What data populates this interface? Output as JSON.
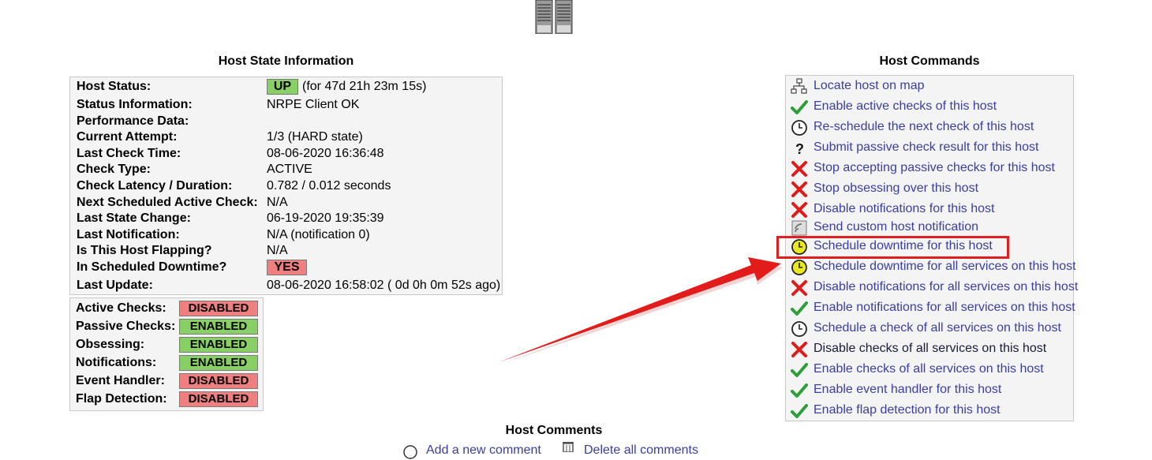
{
  "host_state": {
    "title": "Host State Information",
    "rows": [
      {
        "label": "Host Status:",
        "badge": "UP",
        "value": "(for 47d 21h 23m 15s)"
      },
      {
        "label": "Status Information:",
        "value": "NRPE Client OK"
      },
      {
        "label": "Performance Data:",
        "value": ""
      },
      {
        "label": "Current Attempt:",
        "value": "1/3  (HARD state)"
      },
      {
        "label": "Last Check Time:",
        "value": "08-06-2020 16:36:48"
      },
      {
        "label": "Check Type:",
        "value": "ACTIVE"
      },
      {
        "label": "Check Latency / Duration:",
        "value": "0.782 / 0.012 seconds"
      },
      {
        "label": "Next Scheduled Active Check:",
        "value": "N/A"
      },
      {
        "label": "Last State Change:",
        "value": "06-19-2020 19:35:39"
      },
      {
        "label": "Last Notification:",
        "value": "N/A (notification 0)"
      },
      {
        "label": "Is This Host Flapping?",
        "value": "N/A"
      },
      {
        "label": "In Scheduled Downtime?",
        "badge": "YES",
        "value": ""
      },
      {
        "label": "Last Update:",
        "value": "08-06-2020 16:58:02  ( 0d 0h 0m 52s ago)"
      }
    ]
  },
  "checks": [
    {
      "label": "Active Checks:",
      "status": "DISABLED"
    },
    {
      "label": "Passive Checks:",
      "status": "ENABLED"
    },
    {
      "label": "Obsessing:",
      "status": "ENABLED"
    },
    {
      "label": "Notifications:",
      "status": "ENABLED"
    },
    {
      "label": "Event Handler:",
      "status": "DISABLED"
    },
    {
      "label": "Flap Detection:",
      "status": "DISABLED"
    }
  ],
  "host_commands": {
    "title": "Host Commands",
    "items": [
      {
        "icon": "map-icon",
        "label": "Locate host on map"
      },
      {
        "icon": "checkmark-icon",
        "label": "Enable active checks of this host"
      },
      {
        "icon": "clock-icon",
        "label": "Re-schedule the next check of this host"
      },
      {
        "icon": "question-icon",
        "label": "Submit passive check result for this host"
      },
      {
        "icon": "red-x-icon",
        "label": "Stop accepting passive checks for this host"
      },
      {
        "icon": "red-x-icon",
        "label": "Stop obsessing over this host"
      },
      {
        "icon": "red-x-icon",
        "label": "Disable notifications for this host"
      },
      {
        "icon": "notify-icon",
        "label": "Send custom host notification"
      },
      {
        "icon": "yellow-clock-icon",
        "label": "Schedule downtime for this host"
      },
      {
        "icon": "yellow-clock-icon",
        "label": "Schedule downtime for all services on this host"
      },
      {
        "icon": "red-x-icon",
        "label": "Disable notifications for all services on this host"
      },
      {
        "icon": "checkmark-icon",
        "label": "Enable notifications for all services on this host"
      },
      {
        "icon": "clock-icon",
        "label": "Schedule a check of all services on this host"
      },
      {
        "icon": "red-x-icon",
        "label": "Disable checks of all services on this host"
      },
      {
        "icon": "checkmark-icon",
        "label": "Enable checks of all services on this host"
      },
      {
        "icon": "checkmark-icon",
        "label": "Enable event handler for this host"
      },
      {
        "icon": "checkmark-icon",
        "label": "Enable flap detection for this host"
      }
    ]
  },
  "host_comments": {
    "title": "Host Comments",
    "add_label": "Add a new comment",
    "delete_label": "Delete all comments"
  },
  "colors": {
    "up": "#88d066",
    "enabled": "#88d066",
    "disabled": "#f08080",
    "link": "#3a3ea0",
    "highlight": "#e02020"
  }
}
